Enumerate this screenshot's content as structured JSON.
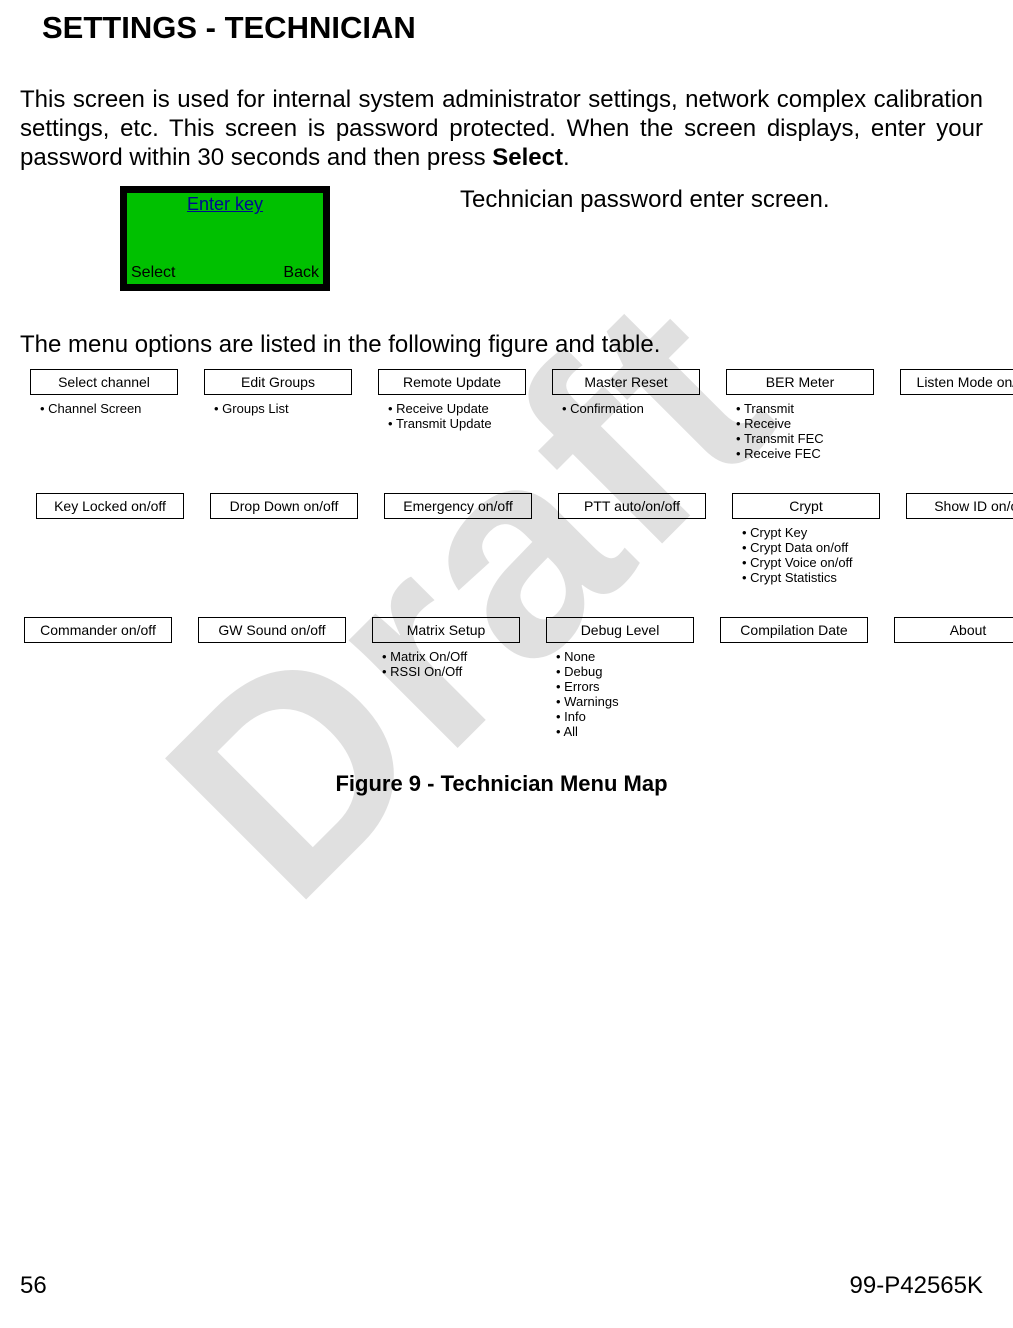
{
  "watermark": "Draft",
  "heading": "SETTINGS - TECHNICIAN",
  "intro_pre": "This screen is used for internal system administrator settings, network complex calibration settings, etc. This screen is password protected. When the screen displays, enter your password within 30 seconds and then press ",
  "intro_bold": "Select",
  "intro_post": ".",
  "lcd": {
    "title": "Enter key",
    "left": "Select",
    "right": "Back"
  },
  "screen_caption": "Technician password enter screen.",
  "menu_line": "The menu options are listed in the following figure and table.",
  "rows": [
    [
      {
        "label": "Select channel",
        "items": [
          "Channel Screen"
        ]
      },
      {
        "label": "Edit Groups",
        "items": [
          "Groups List"
        ]
      },
      {
        "label": "Remote Update",
        "items": [
          "Receive Update",
          "Transmit Update"
        ]
      },
      {
        "label": "Master Reset",
        "items": [
          "Confirmation"
        ]
      },
      {
        "label": "BER Meter",
        "items": [
          "Transmit",
          "Receive",
          "Transmit FEC",
          "Receive FEC"
        ]
      },
      {
        "label": "Listen Mode on/off",
        "items": []
      }
    ],
    [
      {
        "label": "Key Locked on/off",
        "items": []
      },
      {
        "label": "Drop Down on/off",
        "items": []
      },
      {
        "label": "Emergency on/off",
        "items": []
      },
      {
        "label": "PTT auto/on/off",
        "items": []
      },
      {
        "label": "Crypt",
        "items": [
          "Crypt Key",
          "Crypt Data on/off",
          "Crypt Voice on/off",
          "Crypt Statistics"
        ]
      },
      {
        "label": "Show ID on/off",
        "items": []
      }
    ],
    [
      {
        "label": "Commander on/off",
        "items": []
      },
      {
        "label": "GW Sound on/off",
        "items": []
      },
      {
        "label": "Matrix Setup",
        "items": [
          "Matrix On/Off",
          "RSSI On/Off"
        ]
      },
      {
        "label": "Debug Level",
        "items": [
          "None",
          "Debug",
          "Errors",
          "Warnings",
          "Info",
          "All"
        ]
      },
      {
        "label": "Compilation Date",
        "items": []
      },
      {
        "label": "About",
        "items": []
      }
    ]
  ],
  "figure_caption": "Figure 9 - Technician Menu Map",
  "footer": {
    "page": "56",
    "doc": "99-P42565K"
  }
}
